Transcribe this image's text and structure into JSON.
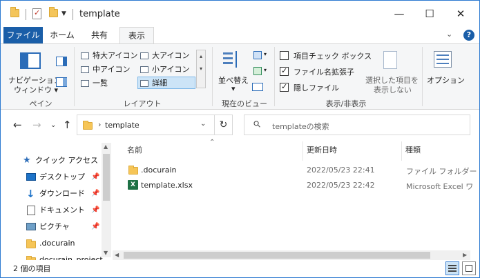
{
  "window": {
    "title": "template",
    "minimize": "—",
    "maximize": "☐",
    "close": "✕"
  },
  "ribbon_tabs": {
    "file": "ファイル",
    "home": "ホーム",
    "share": "共有",
    "view": "表示"
  },
  "ribbon": {
    "pane_group": {
      "nav_pane_line1": "ナビゲーション",
      "nav_pane_line2": "ウィンドウ ▾",
      "label": "ペイン"
    },
    "layout_group": {
      "items": {
        "extra_large": "特大アイコン",
        "large": "大アイコン",
        "medium": "中アイコン",
        "small": "小アイコン",
        "list": "一覧",
        "details": "詳細"
      },
      "selected": "詳細",
      "label": "レイアウト"
    },
    "current_view_group": {
      "sort_by": "並べ替え",
      "label": "現在のビュー"
    },
    "show_hide_group": {
      "item_check_boxes": "項目チェック ボックス",
      "file_name_extensions": "ファイル名拡張子",
      "hidden_items": "隠しファイル",
      "hide_selected_line1": "選択した項目を",
      "hide_selected_line2": "表示しない",
      "label": "表示/非表示",
      "checks": {
        "item_check_boxes": false,
        "file_name_extensions": true,
        "hidden_items": true
      }
    },
    "options": "オプション"
  },
  "address": {
    "path": "template",
    "search_placeholder": "templateの検索"
  },
  "navpane": {
    "items": [
      {
        "label": "クイック アクセス",
        "icon": "star-icon",
        "pinned": false
      },
      {
        "label": "デスクトップ",
        "icon": "desktop-icon",
        "pinned": true
      },
      {
        "label": "ダウンロード",
        "icon": "download-icon",
        "pinned": true
      },
      {
        "label": "ドキュメント",
        "icon": "document-icon",
        "pinned": true
      },
      {
        "label": "ピクチャ",
        "icon": "picture-icon",
        "pinned": true
      },
      {
        "label": ".docurain",
        "icon": "folder-icon",
        "pinned": false
      },
      {
        "label": "docurain_project",
        "icon": "folder-icon",
        "pinned": false
      }
    ]
  },
  "columns": {
    "name": "名前",
    "date": "更新日時",
    "type": "種類"
  },
  "files": [
    {
      "name": ".docurain",
      "date": "2022/05/23 22:41",
      "type": "ファイル フォルダー",
      "icon": "folder-icon"
    },
    {
      "name": "template.xlsx",
      "date": "2022/05/23 22:42",
      "type": "Microsoft Excel ワ",
      "icon": "excel-icon"
    }
  ],
  "status": {
    "item_count": "2 個の項目"
  }
}
